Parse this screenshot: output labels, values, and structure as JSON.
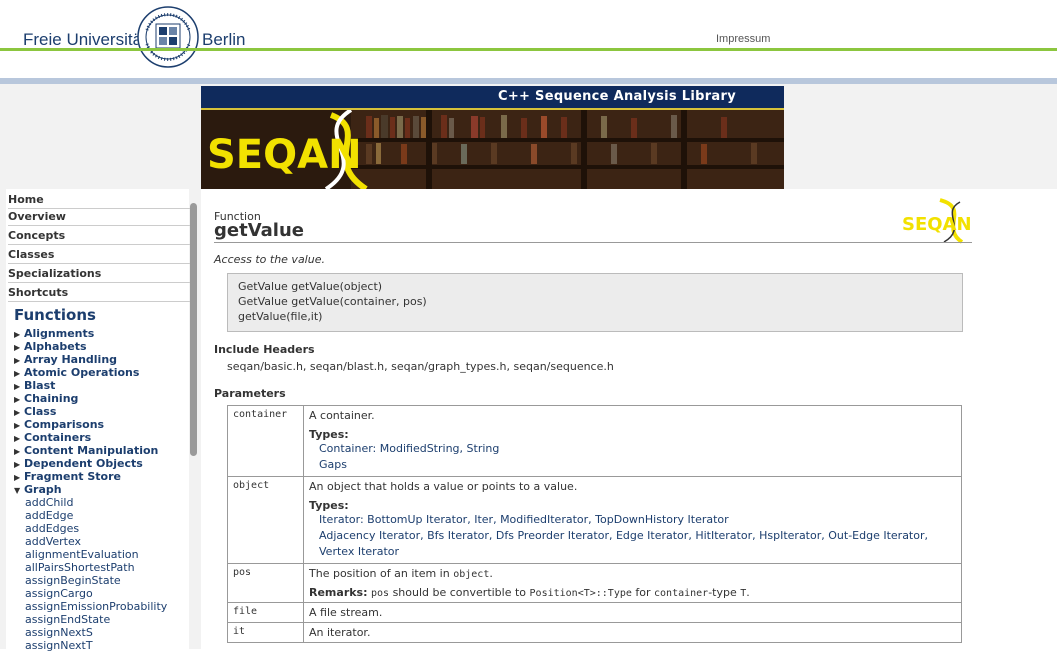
{
  "header": {
    "university_left": "Freie Universität",
    "university_right": "Berlin",
    "impressum": "Impressum"
  },
  "banner": {
    "title": "C++ Sequence Analysis Library",
    "logo_text": "SEQAN"
  },
  "nav": {
    "items": [
      "Home",
      "Overview",
      "Concepts",
      "Classes",
      "Specializations",
      "Shortcuts"
    ],
    "functions_title": "Functions",
    "categories": [
      "Alignments",
      "Alphabets",
      "Array Handling",
      "Atomic Operations",
      "Blast",
      "Chaining",
      "Class",
      "Comparisons",
      "Containers",
      "Content Manipulation",
      "Dependent Objects",
      "Fragment Store",
      "Graph"
    ],
    "graph_items": [
      "addChild",
      "addEdge",
      "addEdges",
      "addVertex",
      "alignmentEvaluation",
      "allPairsShortestPath",
      "assignBeginState",
      "assignCargo",
      "assignEmissionProbability",
      "assignEndState",
      "assignNextS",
      "assignNextT"
    ]
  },
  "page": {
    "kind": "Function",
    "name": "getValue",
    "description": "Access to the value.",
    "signatures": [
      "GetValue getValue(object)",
      "GetValue getValue(container, pos)",
      "getValue(file,it)"
    ],
    "include_heading": "Include Headers",
    "include_headers": "seqan/basic.h, seqan/blast.h, seqan/graph_types.h, seqan/sequence.h",
    "params_heading": "Parameters",
    "params": {
      "container": {
        "name": "container",
        "desc": "A container.",
        "types_label": "Types:",
        "types_line1a": "Container: ModifiedString",
        "types_line1b": "String",
        "types_line2": "Gaps"
      },
      "object": {
        "name": "object",
        "desc": "An object that holds a value or points to a value.",
        "types_label": "Types:",
        "types": [
          "Iterator: BottomUp Iterator",
          "Iter",
          "ModifiedIterator",
          "TopDownHistory Iterator",
          "Adjacency Iterator",
          "Bfs Iterator",
          "Dfs Preorder Iterator",
          "Edge Iterator",
          "HitIterator",
          "HspIterator",
          "Out-Edge Iterator",
          "Vertex Iterator"
        ]
      },
      "pos": {
        "name": "pos",
        "desc_prefix": "The position of an item in",
        "desc_code": "object",
        "desc_suffix": ".",
        "remarks_label": "Remarks:",
        "remarks_code1": "pos",
        "remarks_text1": "should be convertible to",
        "remarks_code2": "Position<T>::Type",
        "remarks_text2": "for",
        "remarks_code3": "container",
        "remarks_text3": "-type",
        "remarks_code4": "T",
        "remarks_text4": "."
      },
      "file": {
        "name": "file",
        "desc": "A file stream."
      },
      "it": {
        "name": "it",
        "desc": "An iterator."
      }
    }
  },
  "colors": {
    "accent_green": "#8cc63f",
    "banner_navy": "#0f2a5c",
    "link_blue": "#1c3e6e",
    "logo_yellow": "#f2e100"
  }
}
